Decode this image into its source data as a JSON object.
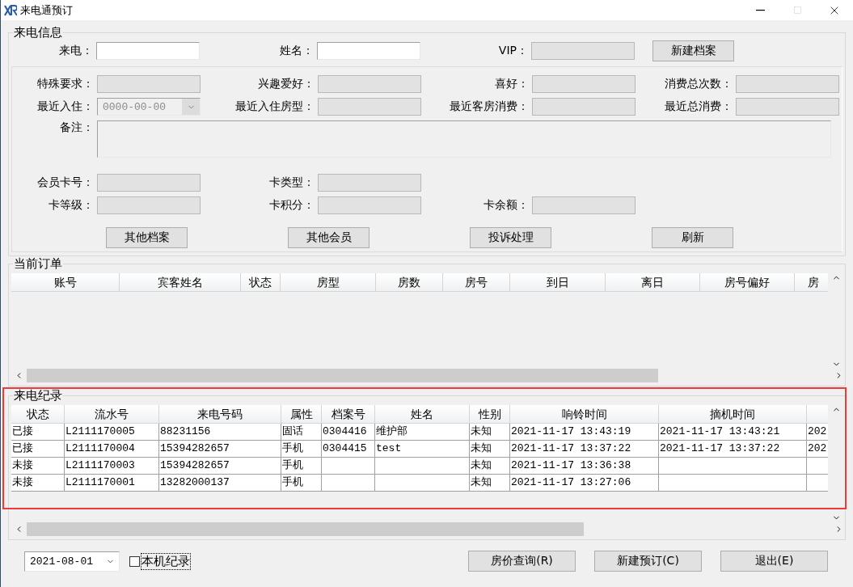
{
  "window": {
    "title": "来电通预订"
  },
  "caller_info": {
    "title": "来电信息",
    "top_fields": [
      {
        "label": "来电：",
        "disabled": false
      },
      {
        "label": "姓名：",
        "disabled": false
      },
      {
        "label": "VIP：",
        "disabled": true
      }
    ],
    "new_profile_button": "新建档案",
    "detail_rows": [
      [
        {
          "kind": "text",
          "label": "特殊要求："
        },
        {
          "kind": "text",
          "label": "兴趣爱好："
        },
        {
          "kind": "text",
          "label": "喜好："
        },
        {
          "kind": "text",
          "label": "消费总次数："
        }
      ],
      [
        {
          "kind": "date",
          "label": "最近入住：",
          "value": "0000-00-00"
        },
        {
          "kind": "text",
          "label": "最近入住房型："
        },
        {
          "kind": "text",
          "label": "最近客房消费："
        },
        {
          "kind": "text",
          "label": "最近总消费："
        }
      ],
      [
        {
          "kind": "memo",
          "label": "备注："
        }
      ],
      [
        {
          "kind": "text",
          "label": "会员卡号："
        },
        {
          "kind": "text",
          "label": "卡类型："
        }
      ],
      [
        {
          "kind": "text",
          "label": "卡等级："
        },
        {
          "kind": "text",
          "label": "卡积分："
        },
        {
          "kind": "text",
          "label": "卡余额："
        }
      ]
    ],
    "buttons": [
      "其他档案",
      "其他会员",
      "投诉处理",
      "刷新"
    ]
  },
  "current_orders": {
    "title": "当前订单",
    "columns": [
      "账号",
      "宾客姓名",
      "状态",
      "房型",
      "房数",
      "房号",
      "到日",
      "离日",
      "房号偏好",
      "房"
    ]
  },
  "call_log": {
    "title": "来电纪录",
    "columns": [
      "状态",
      "流水号",
      "来电号码",
      "属性",
      "档案号",
      "姓名",
      "性别",
      "响铃时间",
      "摘机时间"
    ],
    "rows": [
      [
        "已接",
        "L2111170005",
        "88231156",
        "固话",
        "0304416",
        "维护部",
        "未知",
        "2021-11-17 13:43:19",
        "2021-11-17 13:43:21",
        "202"
      ],
      [
        "已接",
        "L2111170004",
        "15394282657",
        "手机",
        "0304415",
        "test",
        "未知",
        "2021-11-17 13:37:22",
        "2021-11-17 13:37:22",
        "202"
      ],
      [
        "未接",
        "L2111170003",
        "15394282657",
        "手机",
        null,
        null,
        "未知",
        "2021-11-17 13:36:38",
        null,
        null
      ],
      [
        "未接",
        "L2111170001",
        "13282000137",
        "手机",
        null,
        null,
        "未知",
        "2021-11-17 13:27:06",
        null,
        null
      ]
    ]
  },
  "footer": {
    "date": "2021-08-01",
    "local_only": {
      "label": "本机纪录",
      "checked": false,
      "focused": true
    },
    "buttons": [
      "房价查询(R)",
      "新建预订(C)",
      "退出(E)"
    ]
  }
}
